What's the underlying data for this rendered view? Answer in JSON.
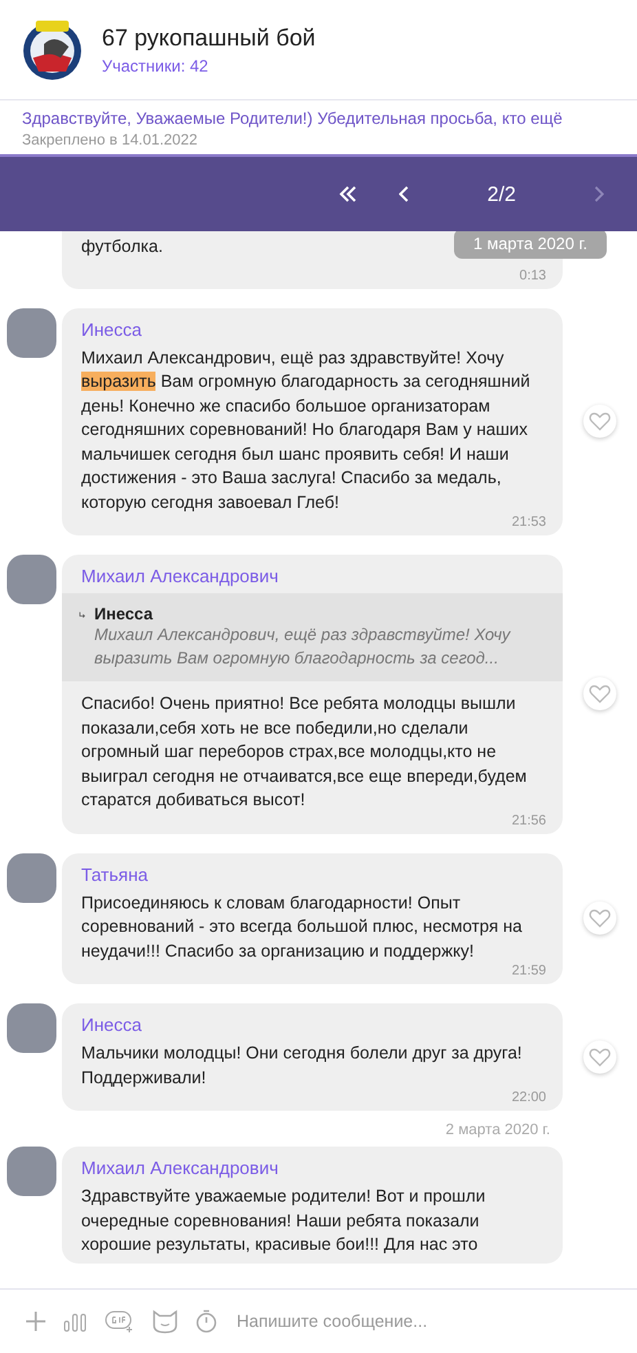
{
  "chat": {
    "title": "67 рукопашный бой",
    "members": "Участники: 42"
  },
  "pinned": {
    "text": "Здравствуйте, Уважаемые Родители!) Убедительная просьба, кто ещё",
    "date": "Закреплено в 14.01.2022"
  },
  "search_nav": {
    "counter": "2/2",
    "next_disabled": true
  },
  "floating_date": "1 марта 2020 г.",
  "items": [
    {
      "kind": "message",
      "text_parts": [
        {
          "text": "футболка.",
          "highlighted": false
        }
      ],
      "time": "0:13",
      "like_button": false
    },
    {
      "kind": "message",
      "author": "Инесса",
      "text_parts": [
        {
          "text": "Михаил Александрович, ещё раз здравствуйте! Хочу ",
          "highlighted": false
        },
        {
          "text": "выразить",
          "highlighted": true
        },
        {
          "text": " Вам  огромную благодарность за сегодняшний день! Конечно же спасибо большое организаторам сегодняшних соревнований! Но благодаря Вам у наших мальчишек сегодня был шанс проявить себя! И наши достижения - это Ваша заслуга! Спасибо за медаль, которую сегодня завоевал Глеб!",
          "highlighted": false
        }
      ],
      "time": "21:53",
      "like_button": true
    },
    {
      "kind": "message",
      "author": "Михаил Александрович",
      "reply": {
        "author": "Инесса",
        "text": "Михаил Александрович, ещё раз здравствуйте! Хочу выразить Вам  огромную благодарность за сегод..."
      },
      "text_parts": [
        {
          "text": "Спасибо! Очень приятно! Все ребята молодцы вышли показали,себя хоть не все победили,но сделали огромный шаг переборов страх,все молодцы,кто не выиграл сегодня не отчаиватся,все еще впереди,будем старатся добиваться высот!",
          "highlighted": false
        }
      ],
      "time": "21:56",
      "like_button": true
    },
    {
      "kind": "message",
      "author": "Татьяна",
      "text_parts": [
        {
          "text": "Присоединяюсь к словам благодарности! Опыт соревнований - это всегда большой плюс, несмотря на неудачи!!! Спасибо за организацию и поддержку!",
          "highlighted": false
        }
      ],
      "time": "21:59",
      "like_button": true
    },
    {
      "kind": "message",
      "author": "Инесса",
      "text_parts": [
        {
          "text": "Мальчики молодцы! Они сегодня болели друг за друга! Поддерживали!",
          "highlighted": false
        }
      ],
      "time": "22:00",
      "like_button": true
    },
    {
      "kind": "date",
      "text": "2 марта 2020 г."
    },
    {
      "kind": "message",
      "author": "Михаил Александрович",
      "text_parts": [
        {
          "text": "Здравствуйте уважаемые родители! Вот и прошли очередные соревнования! Наши ребята показали хорошие результаты, красивые бои!!! Для нас это",
          "highlighted": false
        }
      ],
      "like_button": false
    }
  ],
  "composer": {
    "placeholder": "Напишите сообщение..."
  }
}
